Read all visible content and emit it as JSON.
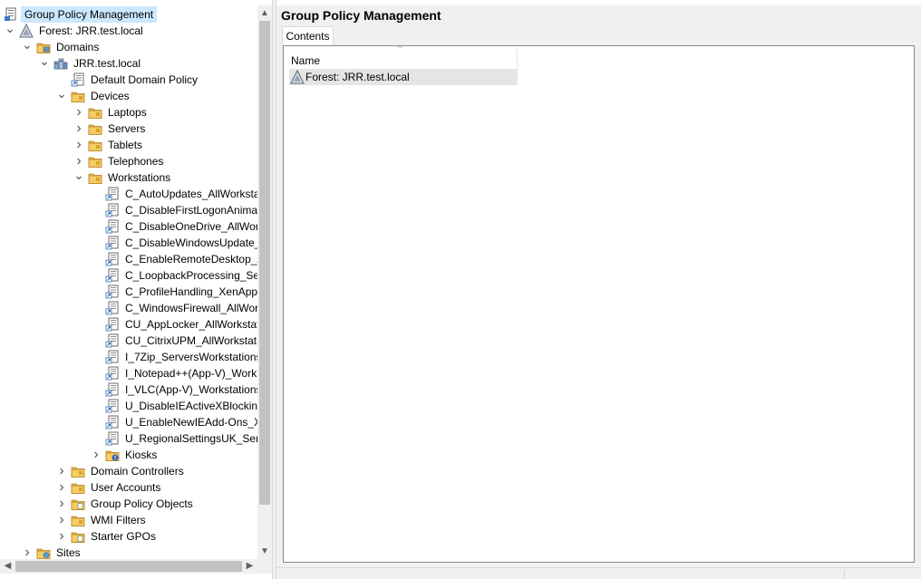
{
  "tree": {
    "items": [
      {
        "label": "Group Policy Management",
        "icon": "gpm-icon",
        "depth": 0,
        "expander": "none",
        "selected": true
      },
      {
        "label": "Forest: JRR.test.local",
        "icon": "forest-icon",
        "depth": 0,
        "expander": "expanded"
      },
      {
        "label": "Domains",
        "icon": "domains-folder-icon",
        "depth": 1,
        "expander": "expanded"
      },
      {
        "label": "JRR.test.local",
        "icon": "domain-icon",
        "depth": 2,
        "expander": "expanded"
      },
      {
        "label": "Default Domain Policy",
        "icon": "gpo-link-icon",
        "depth": 3,
        "expander": "none"
      },
      {
        "label": "Devices",
        "icon": "ou-folder-icon",
        "depth": 3,
        "expander": "expanded"
      },
      {
        "label": "Laptops",
        "icon": "ou-folder-icon",
        "depth": 4,
        "expander": "collapsed"
      },
      {
        "label": "Servers",
        "icon": "ou-folder-icon",
        "depth": 4,
        "expander": "collapsed"
      },
      {
        "label": "Tablets",
        "icon": "ou-folder-icon",
        "depth": 4,
        "expander": "collapsed"
      },
      {
        "label": "Telephones",
        "icon": "ou-folder-icon",
        "depth": 4,
        "expander": "collapsed"
      },
      {
        "label": "Workstations",
        "icon": "ou-folder-icon",
        "depth": 4,
        "expander": "expanded"
      },
      {
        "label": "C_AutoUpdates_AllWorksta",
        "icon": "gpo-link-icon",
        "depth": 5,
        "expander": "none"
      },
      {
        "label": "C_DisableFirstLogonAnimat",
        "icon": "gpo-link-icon",
        "depth": 5,
        "expander": "none"
      },
      {
        "label": "C_DisableOneDrive_AllWork",
        "icon": "gpo-link-icon",
        "depth": 5,
        "expander": "none"
      },
      {
        "label": "C_DisableWindowsUpdate_",
        "icon": "gpo-link-icon",
        "depth": 5,
        "expander": "none"
      },
      {
        "label": "C_EnableRemoteDesktop_A",
        "icon": "gpo-link-icon",
        "depth": 5,
        "expander": "none"
      },
      {
        "label": "C_LoopbackProcessing_Ser",
        "icon": "gpo-link-icon",
        "depth": 5,
        "expander": "none"
      },
      {
        "label": "C_ProfileHandling_XenApp",
        "icon": "gpo-link-icon",
        "depth": 5,
        "expander": "none"
      },
      {
        "label": "C_WindowsFirewall_AllWor",
        "icon": "gpo-link-icon",
        "depth": 5,
        "expander": "none"
      },
      {
        "label": "CU_AppLocker_AllWorkstat",
        "icon": "gpo-link-icon",
        "depth": 5,
        "expander": "none"
      },
      {
        "label": "CU_CitrixUPM_AllWorkstati",
        "icon": "gpo-link-icon",
        "depth": 5,
        "expander": "none"
      },
      {
        "label": "I_7Zip_ServersWorkstations_",
        "icon": "gpo-link-icon",
        "depth": 5,
        "expander": "none"
      },
      {
        "label": "I_Notepad++(App-V)_Work",
        "icon": "gpo-link-icon",
        "depth": 5,
        "expander": "none"
      },
      {
        "label": "I_VLC(App-V)_Workstations",
        "icon": "gpo-link-icon",
        "depth": 5,
        "expander": "none"
      },
      {
        "label": "U_DisableIEActiveXBlocking",
        "icon": "gpo-link-icon",
        "depth": 5,
        "expander": "none"
      },
      {
        "label": "U_EnableNewIEAdd-Ons_Xe",
        "icon": "gpo-link-icon",
        "depth": 5,
        "expander": "none"
      },
      {
        "label": "U_RegionalSettingsUK_Serv",
        "icon": "gpo-link-icon",
        "depth": 5,
        "expander": "none"
      },
      {
        "label": "Kiosks",
        "icon": "ou-blocked-folder-icon",
        "depth": 5,
        "expander": "collapsed"
      },
      {
        "label": "Domain Controllers",
        "icon": "ou-folder-icon",
        "depth": 3,
        "expander": "collapsed"
      },
      {
        "label": "User Accounts",
        "icon": "ou-folder-icon",
        "depth": 3,
        "expander": "collapsed"
      },
      {
        "label": "Group Policy Objects",
        "icon": "gpo-container-folder-icon",
        "depth": 3,
        "expander": "collapsed"
      },
      {
        "label": "WMI Filters",
        "icon": "ou-folder-icon",
        "depth": 3,
        "expander": "collapsed"
      },
      {
        "label": "Starter GPOs",
        "icon": "gpo-container-folder-icon",
        "depth": 3,
        "expander": "collapsed"
      },
      {
        "label": "Sites",
        "icon": "sites-folder-icon",
        "depth": 1,
        "expander": "collapsed"
      }
    ]
  },
  "right_pane": {
    "title": "Group Policy Management",
    "tab_label": "Contents",
    "column_name": "Name",
    "rows": [
      {
        "label": "Forest: JRR.test.local",
        "icon": "forest-icon"
      }
    ]
  },
  "colors": {
    "selection": "#cce8ff",
    "folder": "#e8b53a",
    "pane_background": "#f0f0f0"
  }
}
